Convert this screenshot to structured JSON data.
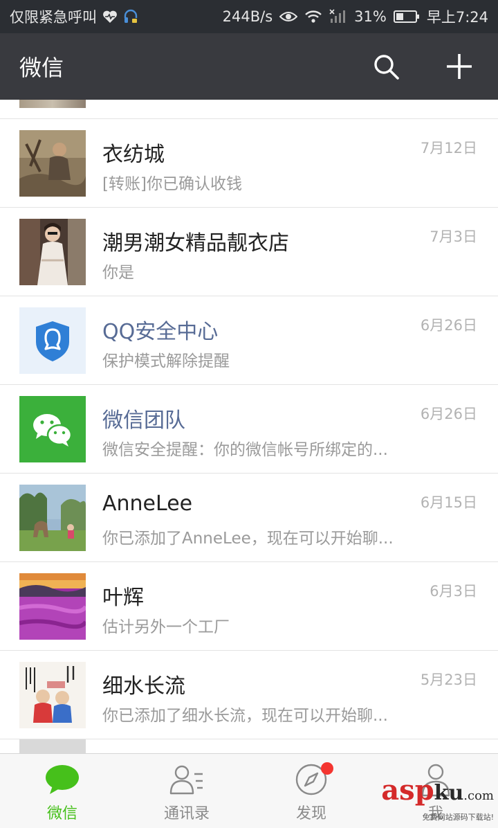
{
  "status_bar": {
    "carrier_text": "仅限紧急呼叫",
    "net_speed": "244B/s",
    "battery": "31%",
    "time": "早上7:24"
  },
  "app_bar": {
    "title": "微信",
    "actions": [
      "search-icon",
      "plus-icon"
    ]
  },
  "chats": [
    {
      "name": "衣纺城",
      "preview": "[转账]你已确认收钱",
      "time": "7月12日",
      "official": false,
      "avatar": "photo-child"
    },
    {
      "name": "潮男潮女精品靓衣店",
      "preview": "你是",
      "time": "7月3日",
      "official": false,
      "avatar": "photo-woman"
    },
    {
      "name": "QQ安全中心",
      "preview": "保护模式解除提醒",
      "time": "6月26日",
      "official": true,
      "avatar": "qq-shield-icon"
    },
    {
      "name": "微信团队",
      "preview": "微信安全提醒：你的微信帐号所绑定的...",
      "time": "6月26日",
      "official": true,
      "avatar": "wechat-logo-icon"
    },
    {
      "name": "AnneLee",
      "preview": "你已添加了AnneLee，现在可以开始聊...",
      "time": "6月15日",
      "official": false,
      "avatar": "photo-kangaroo"
    },
    {
      "name": "叶辉",
      "preview": "估计另外一个工厂",
      "time": "6月3日",
      "official": false,
      "avatar": "photo-flowers"
    },
    {
      "name": "细水长流",
      "preview": "你已添加了细水长流，现在可以开始聊...",
      "time": "5月23日",
      "official": false,
      "avatar": "photo-cartoon-couple"
    }
  ],
  "tabs": [
    {
      "label": "微信",
      "icon": "chat-bubble-icon",
      "active": true
    },
    {
      "label": "通讯录",
      "icon": "contacts-icon",
      "active": false
    },
    {
      "label": "发现",
      "icon": "compass-icon",
      "active": false,
      "badge": true
    },
    {
      "label": "我",
      "icon": "person-icon",
      "active": false
    }
  ],
  "colors": {
    "status_bg": "#2b2e33",
    "app_bar_bg": "#393a3f",
    "accent_green": "#46c01b",
    "official_name": "#576b95",
    "badge_red": "#f43530"
  },
  "watermark": {
    "asp": "asp",
    "ku": "ku",
    "com": ".com",
    "sub": "免费网站源码下载站!"
  }
}
